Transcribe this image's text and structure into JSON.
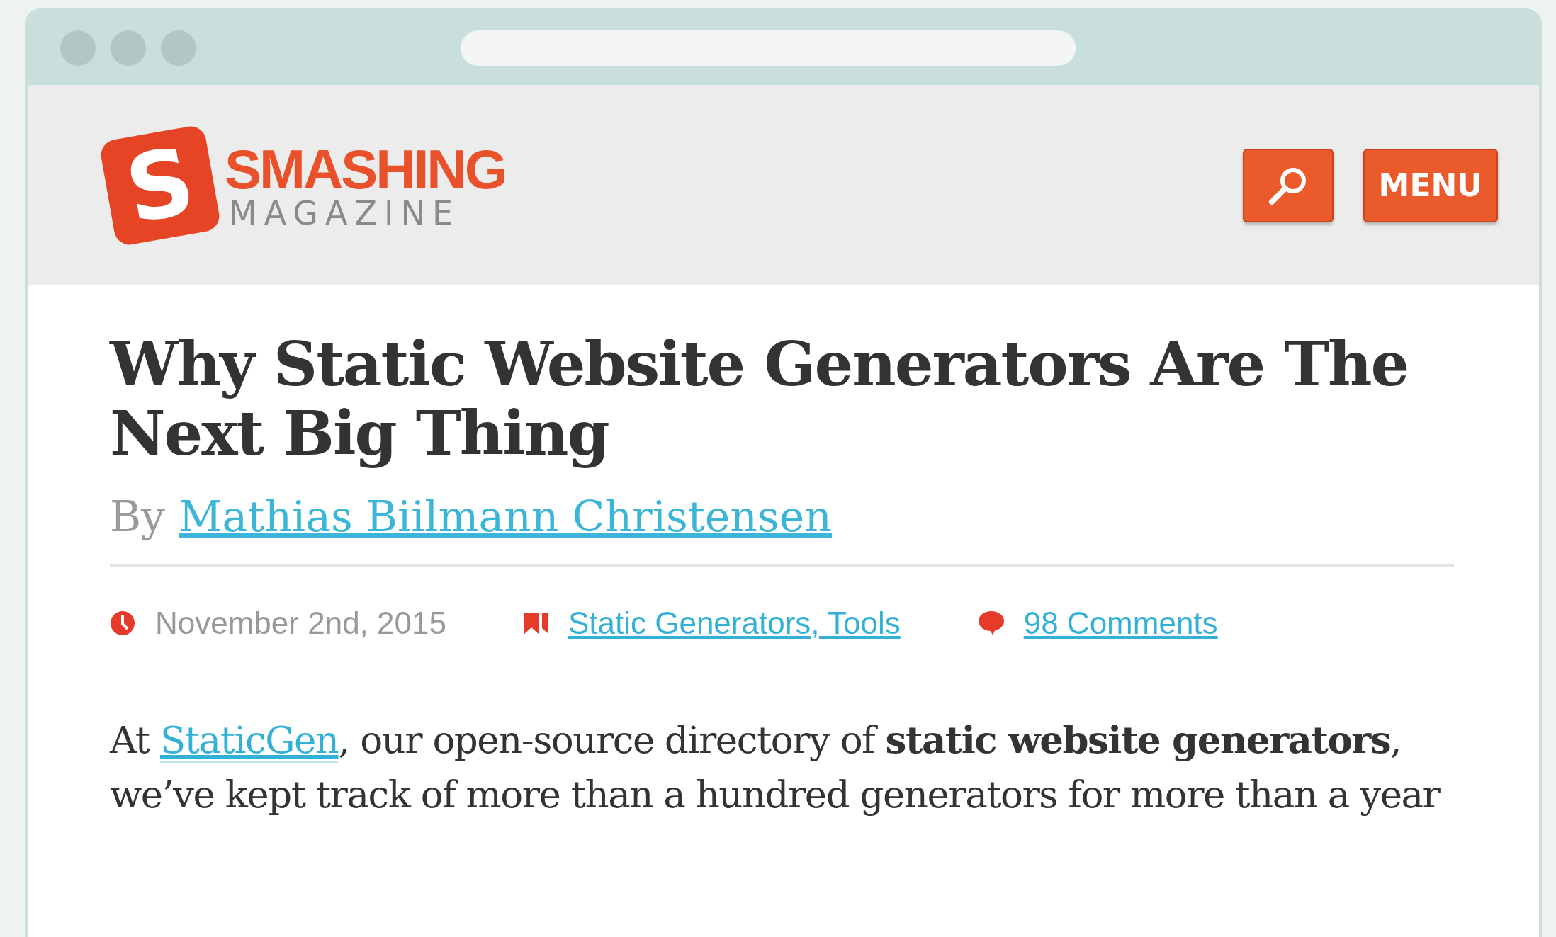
{
  "header": {
    "logo": {
      "mark": "S",
      "title": "SMASHING",
      "subtitle": "MAGAZINE"
    },
    "buttons": [
      {
        "kind": "search"
      },
      {
        "kind": "menu",
        "label": "MENU"
      }
    ]
  },
  "article": {
    "title": "Why Static Website Generators Are The Next Big Thing",
    "byline": {
      "prefix": "By",
      "author": "Mathias Biilmann Christensen"
    },
    "meta": [
      {
        "kind": "date",
        "text": "November 2nd, 2015"
      },
      {
        "kind": "categories",
        "text": "Static Generators, Tools"
      },
      {
        "kind": "comments",
        "text": "98 Comments"
      }
    ],
    "intro": {
      "before": "At ",
      "link": "StaticGen",
      "after": ", our open-source directory of **static website generators**, we’ve kept track of more than a hundred generators for more than a year"
    }
  }
}
